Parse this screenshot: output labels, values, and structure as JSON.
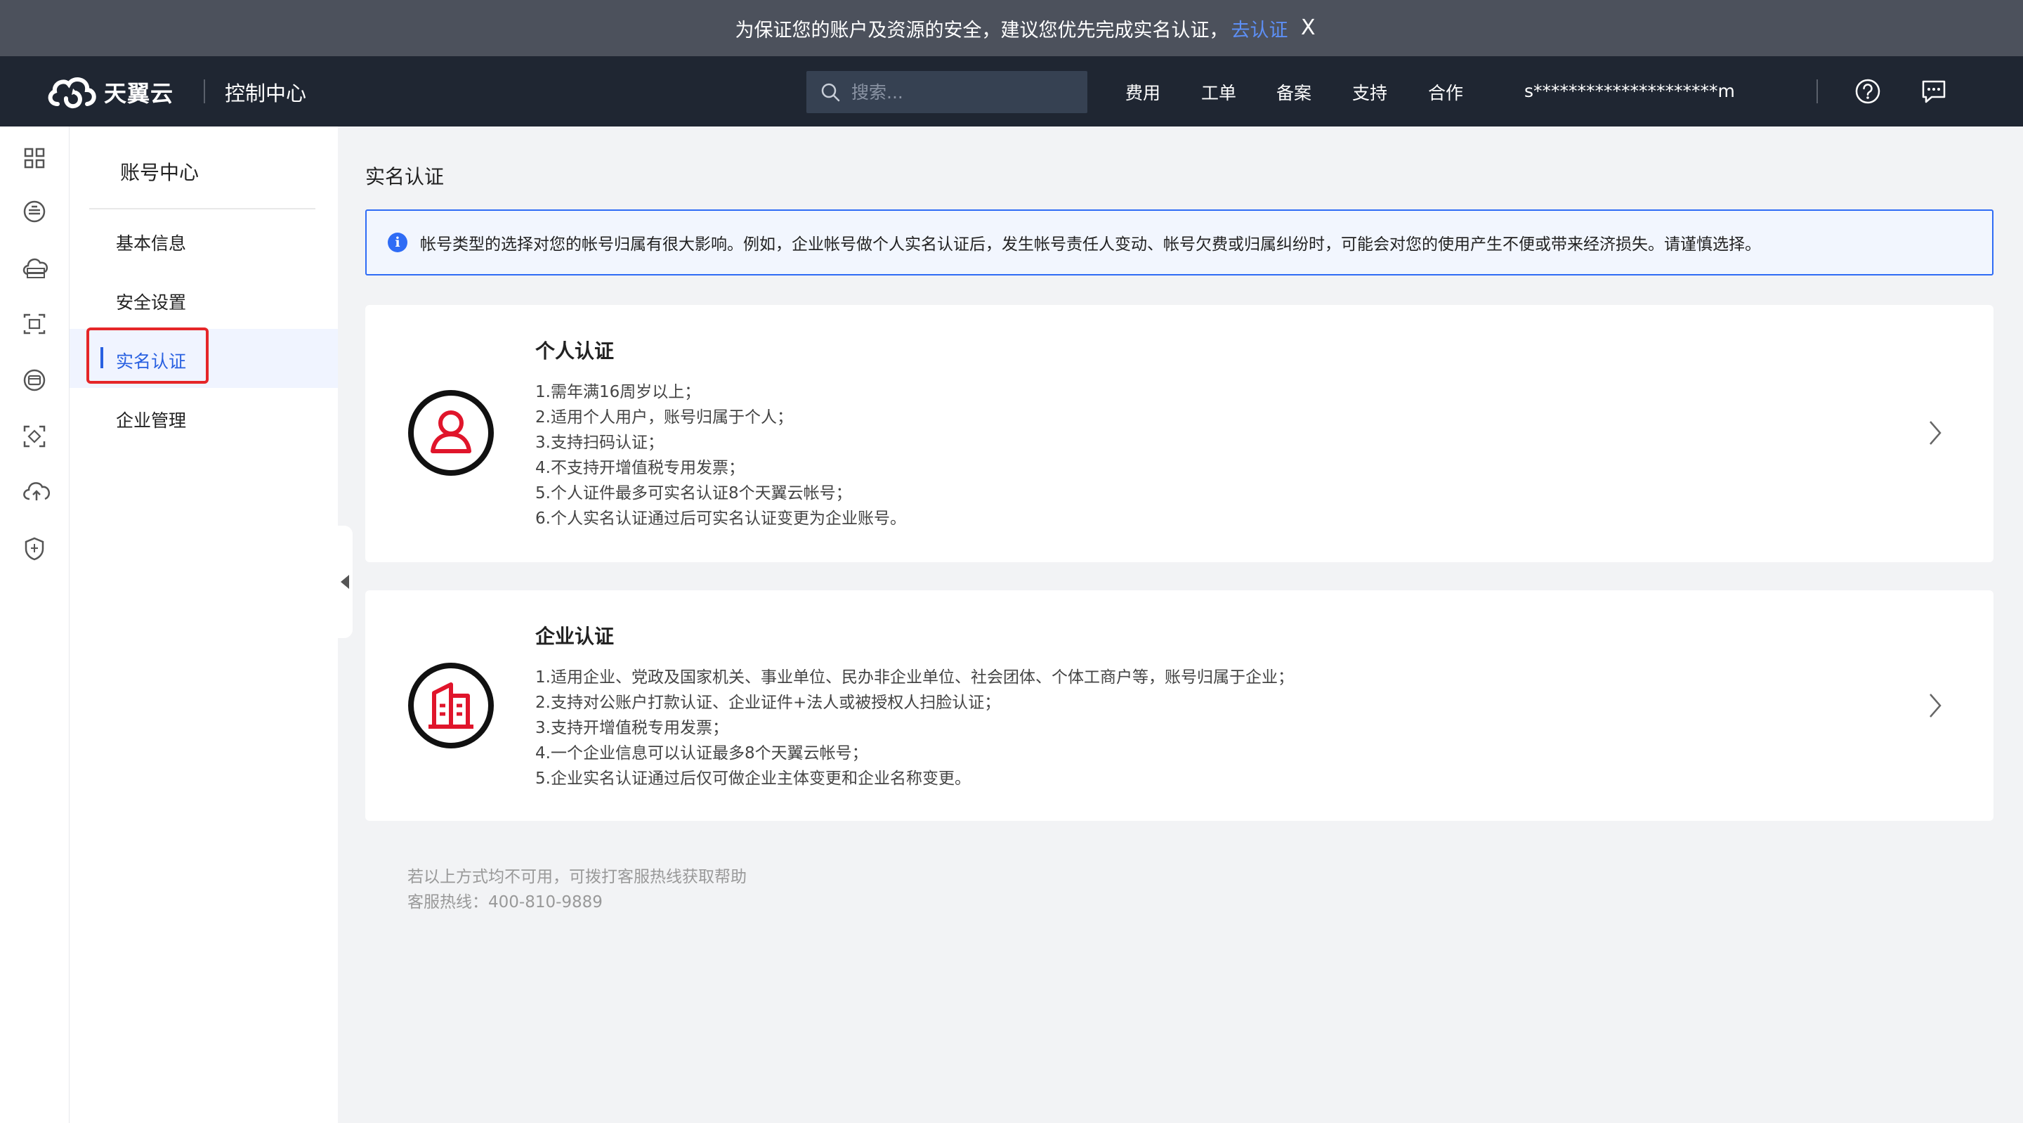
{
  "notice": {
    "text": "为保证您的账户及资源的安全，建议您优先完成实名认证，",
    "link": "去认证",
    "close": "X"
  },
  "header": {
    "brand": "天翼云",
    "console": "控制中心",
    "search_placeholder": "搜索...",
    "nav": [
      "费用",
      "工单",
      "备案",
      "支持",
      "合作"
    ],
    "account": "s*********************m"
  },
  "sidebar": {
    "title": "账号中心",
    "items": [
      {
        "label": "基本信息"
      },
      {
        "label": "安全设置"
      },
      {
        "label": "实名认证",
        "active": true
      },
      {
        "label": "企业管理"
      }
    ]
  },
  "main": {
    "title": "实名认证",
    "info": "帐号类型的选择对您的帐号归属有很大影响。例如，企业帐号做个人实名认证后，发生帐号责任人变动、帐号欠费或归属纠纷时，可能会对您的使用产生不便或带来经济损失。请谨慎选择。",
    "cards": [
      {
        "title": "个人认证",
        "icon": "person-icon",
        "items": [
          "1.需年满16周岁以上；",
          "2.适用个人用户，账号归属于个人；",
          "3.支持扫码认证；",
          "4.不支持开增值税专用发票；",
          "5.个人证件最多可实名认证8个天翼云帐号；",
          "6.个人实名认证通过后可实名认证变更为企业账号。"
        ]
      },
      {
        "title": "企业认证",
        "icon": "building-icon",
        "items": [
          "1.适用企业、党政及国家机关、事业单位、民办非企业单位、社会团体、个体工商户等，账号归属于企业；",
          "2.支持对公账户打款认证、企业证件+法人或被授权人扫脸认证；",
          "3.支持开增值税专用发票；",
          "4.一个企业信息可以认证最多8个天翼云帐号；",
          "5.企业实名认证通过后仅可做企业主体变更和企业名称变更。"
        ]
      }
    ],
    "help": {
      "line1": "若以上方式均不可用，可拨打客服热线获取帮助",
      "line2": "客服热线：400-810-9889"
    }
  },
  "colors": {
    "accent": "#2860e1",
    "brand_red": "#e0152b",
    "header_bg": "#1f2632",
    "notice_bg": "#4c515c",
    "highlight_box": "#e52628"
  }
}
